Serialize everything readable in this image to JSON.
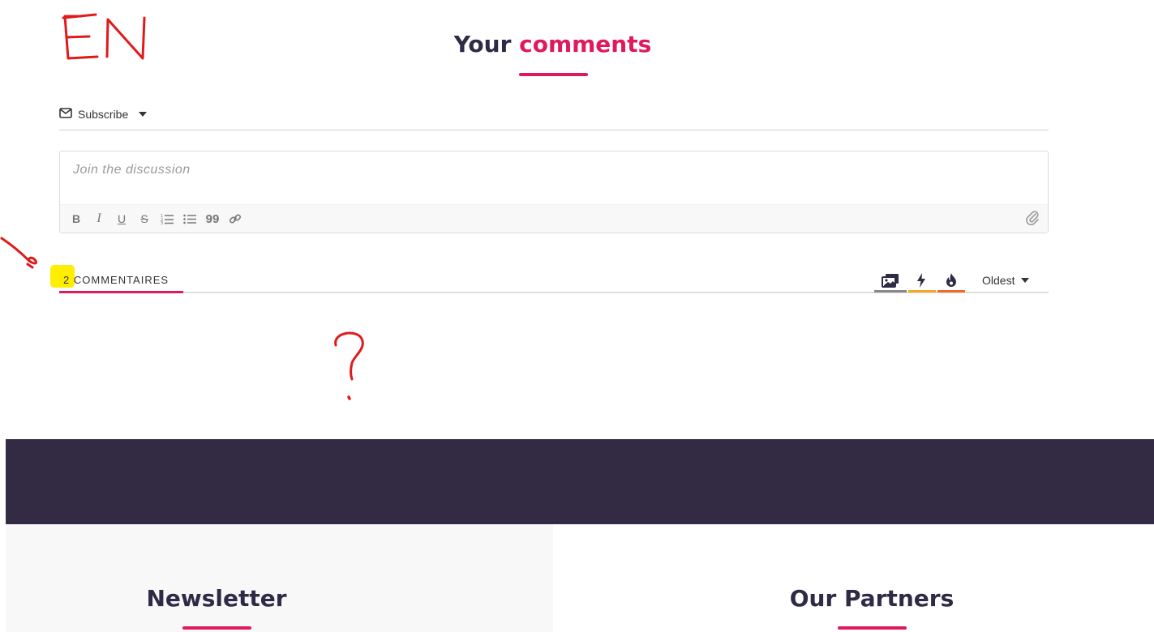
{
  "header": {
    "title_part1": "Your",
    "title_part2": "comments",
    "accent_color": "#e0195f"
  },
  "subscribe": {
    "label": "Subscribe",
    "icon": "envelope-icon"
  },
  "editor": {
    "placeholder": "Join the discussion",
    "toolbar": [
      {
        "name": "bold-button",
        "label": "B"
      },
      {
        "name": "italic-button",
        "label": "I"
      },
      {
        "name": "underline-button",
        "label": "U"
      },
      {
        "name": "strikethrough-button",
        "label": "S"
      },
      {
        "name": "ordered-list-button",
        "icon": "ordered-list-icon"
      },
      {
        "name": "unordered-list-button",
        "icon": "unordered-list-icon"
      },
      {
        "name": "quote-button",
        "label": "99"
      },
      {
        "name": "link-button",
        "icon": "link-icon"
      }
    ],
    "attach_icon": "paperclip-icon"
  },
  "comments": {
    "count": "2",
    "label": "COMMENTAIRES",
    "filters": [
      {
        "name": "media-filter",
        "icon": "images-icon",
        "color": "#888888"
      },
      {
        "name": "newest-filter",
        "icon": "lightning-icon",
        "color": "#f5a623"
      },
      {
        "name": "hottest-filter",
        "icon": "flame-icon",
        "color": "#f26a2e"
      }
    ],
    "sort": {
      "selected": "Oldest"
    }
  },
  "footer": {
    "newsletter_title": "Newsletter",
    "partners_title": "Our Partners",
    "band_color": "#332b44"
  },
  "annotations": {
    "language_note": "EN",
    "question_mark": "?"
  }
}
